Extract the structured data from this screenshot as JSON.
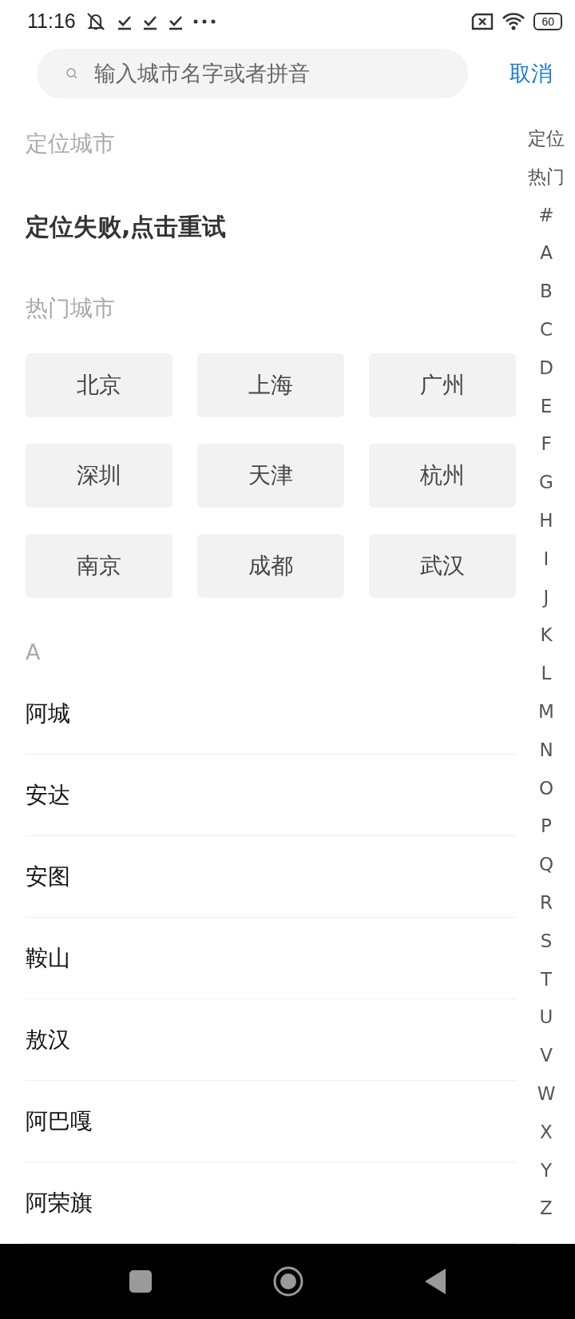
{
  "status_bar": {
    "time": "11:16",
    "battery": "60"
  },
  "search": {
    "placeholder": "输入城市名字或者拼音",
    "cancel": "取消"
  },
  "location": {
    "title": "定位城市",
    "message": "定位失败,点击重试"
  },
  "hot": {
    "title": "热门城市",
    "cities": [
      "北京",
      "上海",
      "广州",
      "深圳",
      "天津",
      "杭州",
      "南京",
      "成都",
      "武汉"
    ]
  },
  "section": {
    "letter": "A",
    "cities": [
      "阿城",
      "安达",
      "安图",
      "鞍山",
      "敖汉",
      "阿巴嘎",
      "阿荣旗"
    ]
  },
  "index": [
    "定位",
    "热门",
    "#",
    "A",
    "B",
    "C",
    "D",
    "E",
    "F",
    "G",
    "H",
    "I",
    "J",
    "K",
    "L",
    "M",
    "N",
    "O",
    "P",
    "Q",
    "R",
    "S",
    "T",
    "U",
    "V",
    "W",
    "X",
    "Y",
    "Z"
  ]
}
